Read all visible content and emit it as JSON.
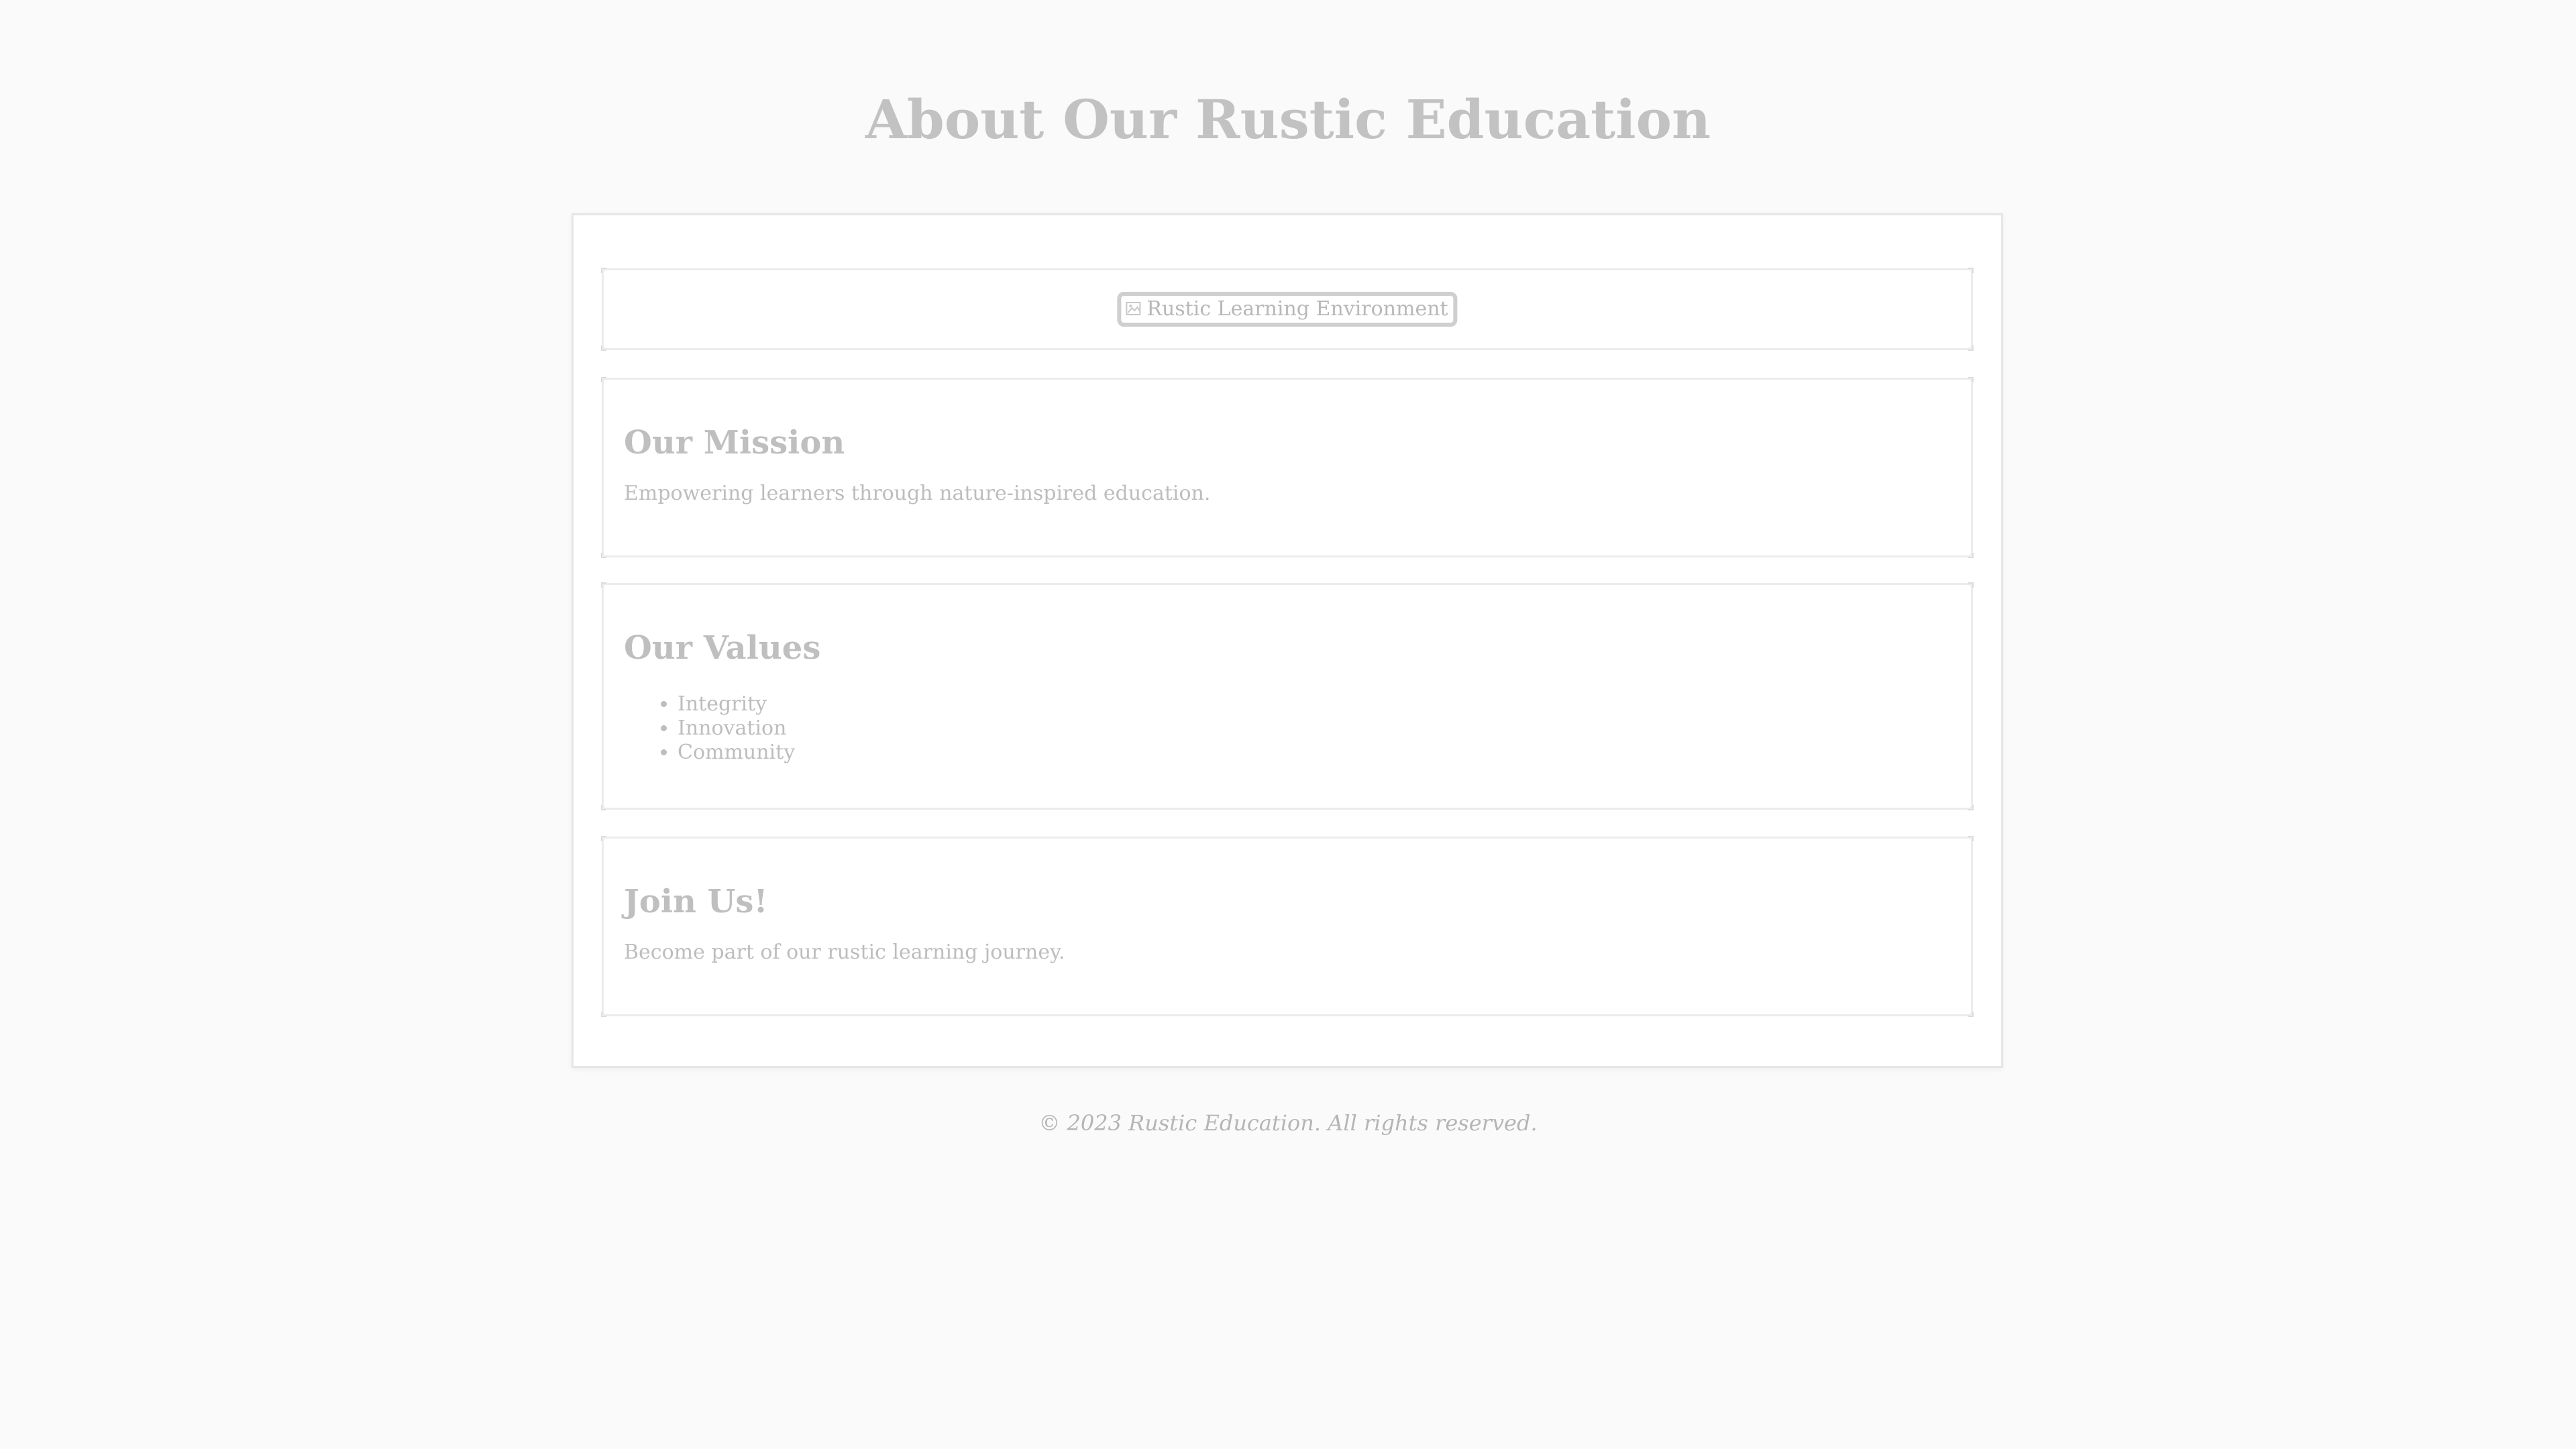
{
  "header": {
    "title": "About Our Rustic Education"
  },
  "image_section": {
    "alt_text": "Rustic Learning Environment",
    "icon": "broken-image-icon"
  },
  "mission": {
    "heading": "Our Mission",
    "text": "Empowering learners through nature-inspired education."
  },
  "values": {
    "heading": "Our Values",
    "items": [
      "Integrity",
      "Innovation",
      "Community"
    ]
  },
  "join": {
    "heading": "Join Us!",
    "text": "Become part of our rustic learning journey."
  },
  "footer": {
    "text": "© 2023 Rustic Education. All rights reserved."
  },
  "colors": {
    "background": "#fafafa",
    "card": "#ffffff",
    "text": "#bdbdbd",
    "border": "#ececec"
  }
}
